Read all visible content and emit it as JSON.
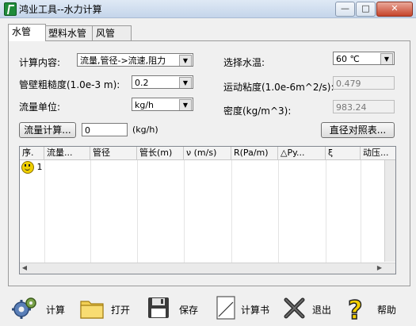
{
  "window": {
    "title": "鸿业工具--水力计算",
    "minimize": "—",
    "maximize": "□",
    "close": "✕"
  },
  "tabs": [
    {
      "label": "水管"
    },
    {
      "label": "塑料水管"
    },
    {
      "label": "风管"
    }
  ],
  "form": {
    "calc_content_label": "计算内容:",
    "calc_content_value": "流量,管径->流速,阻力",
    "roughness_label": "管壁粗糙度(1.0e-3 m):",
    "roughness_value": "0.2",
    "flow_unit_label": "流量单位:",
    "flow_unit_value": "kg/h",
    "flow_calc_button": "流量计算...",
    "flow_value": "0",
    "flow_unit_suffix": "(kg/h)",
    "water_temp_label": "选择水温:",
    "water_temp_value": "60  ℃",
    "viscosity_label": "运动粘度(1.0e-6m^2/s):",
    "viscosity_value": "0.479",
    "density_label": "密度(kg/m^3):",
    "density_value": "983.24",
    "diameter_table_button": "直径对照表..."
  },
  "grid": {
    "columns": [
      "序.",
      "流量...",
      "管径",
      "管长(m)",
      "ν (m/s)",
      "R(Pa/m)",
      "△Py...",
      "ξ",
      "动压..."
    ],
    "rows": [
      {
        "index": "1"
      }
    ]
  },
  "toolbar": {
    "calc_label": "计算",
    "open_label": "打开",
    "save_label": "保存",
    "report_label": "计算书",
    "exit_label": "退出",
    "help_label": "帮助"
  },
  "icons": {
    "calc": "gears-icon",
    "open": "folder-icon",
    "save": "floppy-disk-icon",
    "report": "document-icon",
    "exit": "x-icon",
    "help": "question-icon"
  }
}
